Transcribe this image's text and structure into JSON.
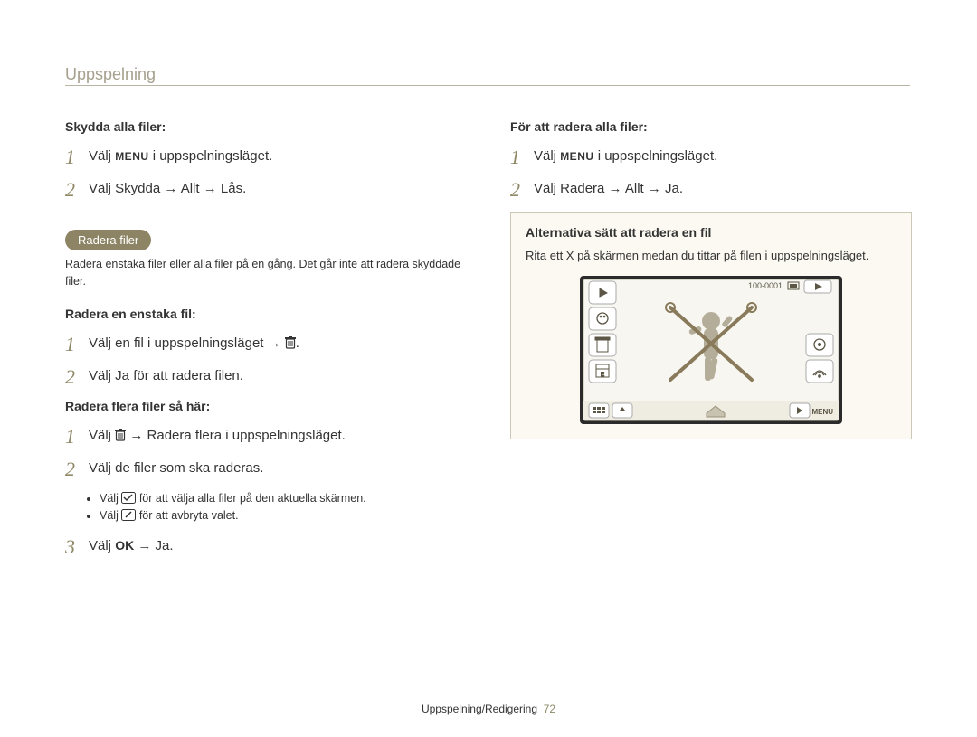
{
  "header": "Uppspelning",
  "footer": {
    "section": "Uppspelning/Redigering",
    "page": "72"
  },
  "left": {
    "protect_all_title": "Skydda alla ﬁler:",
    "protect_steps": [
      {
        "n": "1",
        "before": "Välj ",
        "glyph": "MENU",
        "after": " i uppspelningsläget."
      },
      {
        "n": "2",
        "text": "Välj Skydda → Allt → Lås."
      }
    ],
    "section_badge": "Radera ﬁler",
    "section_desc": "Radera enstaka ﬁler eller alla ﬁler på en gång. Det går inte att radera skyddade ﬁler.",
    "single_title": "Radera en enstaka ﬁl:",
    "single_steps": [
      {
        "n": "1",
        "before": "Välj en ﬁl i uppspelningsläget → ",
        "icon": "trash"
      },
      {
        "n": "2",
        "text": "Välj Ja för att radera ﬁlen."
      }
    ],
    "multi_title": "Radera ﬂera ﬁler så här:",
    "multi_steps": [
      {
        "n": "1",
        "before": "Välj ",
        "icon": "trash",
        "after": " → Radera ﬂera i uppspelningsläget."
      },
      {
        "n": "2",
        "text": "Välj de ﬁler som ska raderas."
      }
    ],
    "bullets": [
      "Välj ",
      "för att välja alla ﬁler på den aktuella skärmen.",
      "Välj ",
      "för att avbryta valet."
    ],
    "step3": {
      "n": "3",
      "before": "Välj ",
      "glyph": "OK",
      "after": " → Ja."
    }
  },
  "right": {
    "delete_all_title": "För att radera alla ﬁler:",
    "delete_all_steps": [
      {
        "n": "1",
        "before": "Välj ",
        "glyph": "MENU",
        "after": " i uppspelningsläget."
      },
      {
        "n": "2",
        "text": "Välj Radera → Allt → Ja."
      }
    ],
    "tip_title": "Alternativa sätt att radera en ﬁl",
    "tip_text": "Rita ett X på skärmen medan du tittar på ﬁlen i uppspelningsläget.",
    "screen_label": "100-0001"
  }
}
